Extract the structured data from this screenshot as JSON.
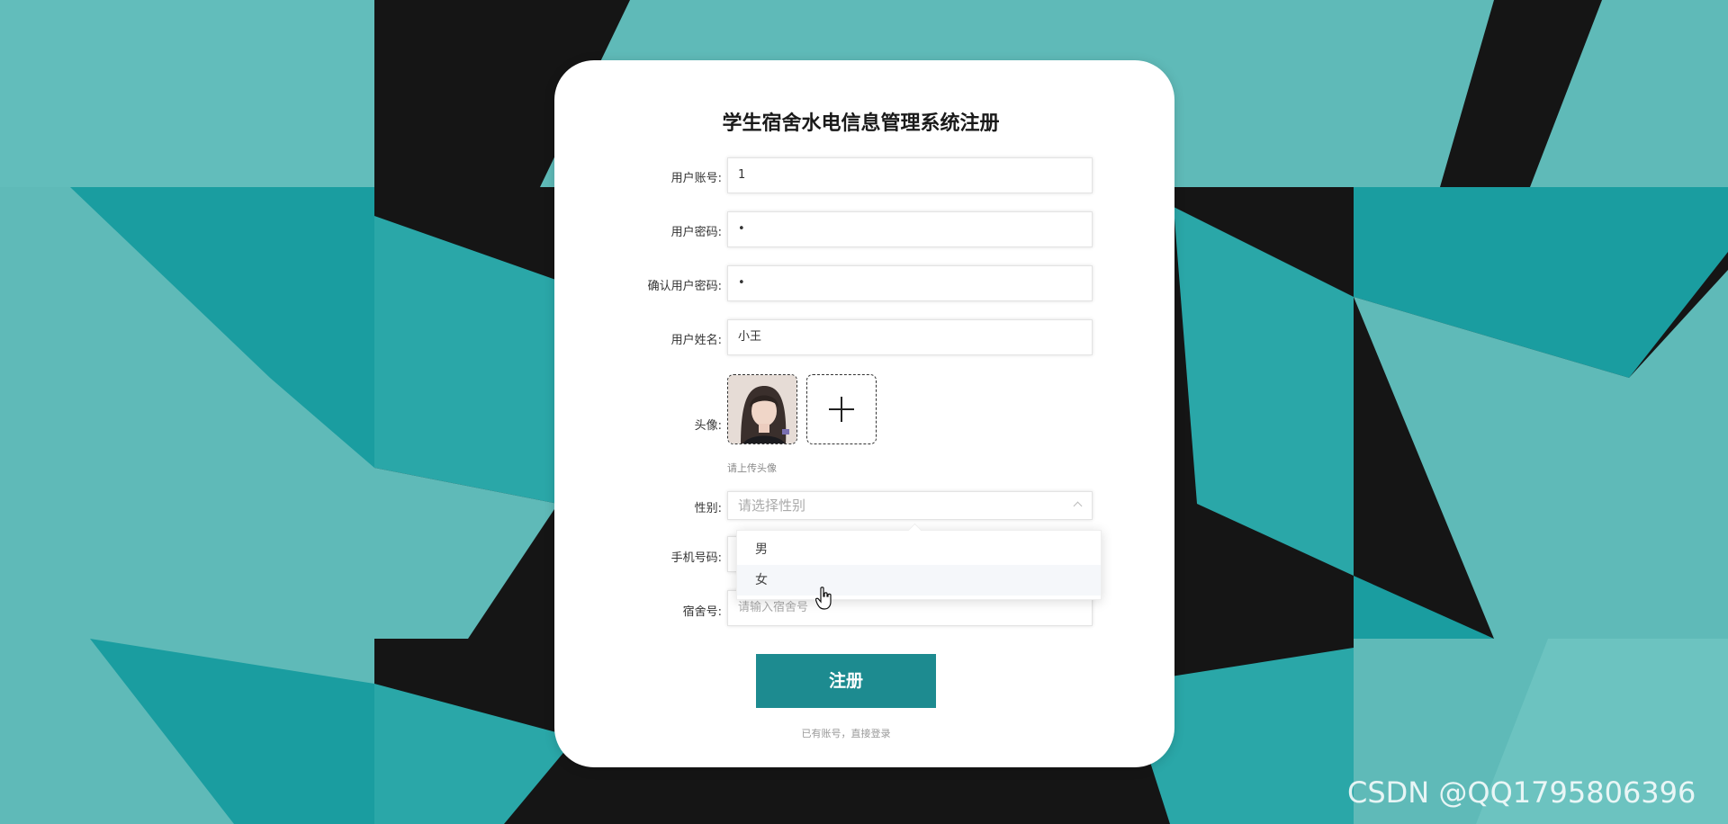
{
  "title": "学生宿舍水电信息管理系统注册",
  "fields": {
    "account": {
      "label": "用户账号:",
      "value": "1"
    },
    "password": {
      "label": "用户密码:",
      "value": "•"
    },
    "confirm": {
      "label": "确认用户密码:",
      "value": "•"
    },
    "name": {
      "label": "用户姓名:",
      "value": "小王"
    },
    "avatar": {
      "label": "头像:",
      "hint": "请上传头像",
      "add_icon": "plus-icon"
    },
    "gender": {
      "label": "性别:",
      "placeholder": "请选择性别",
      "options": [
        "男",
        "女"
      ]
    },
    "phone": {
      "label": "手机号码:"
    },
    "dorm": {
      "label": "宿舍号:",
      "placeholder": "请输入宿舍号"
    }
  },
  "submit_label": "注册",
  "login_link": "已有账号，直接登录",
  "watermark": "CSDN @QQ1795806396",
  "colors": {
    "accent": "#1d8b90",
    "background": "#5fbab8"
  }
}
